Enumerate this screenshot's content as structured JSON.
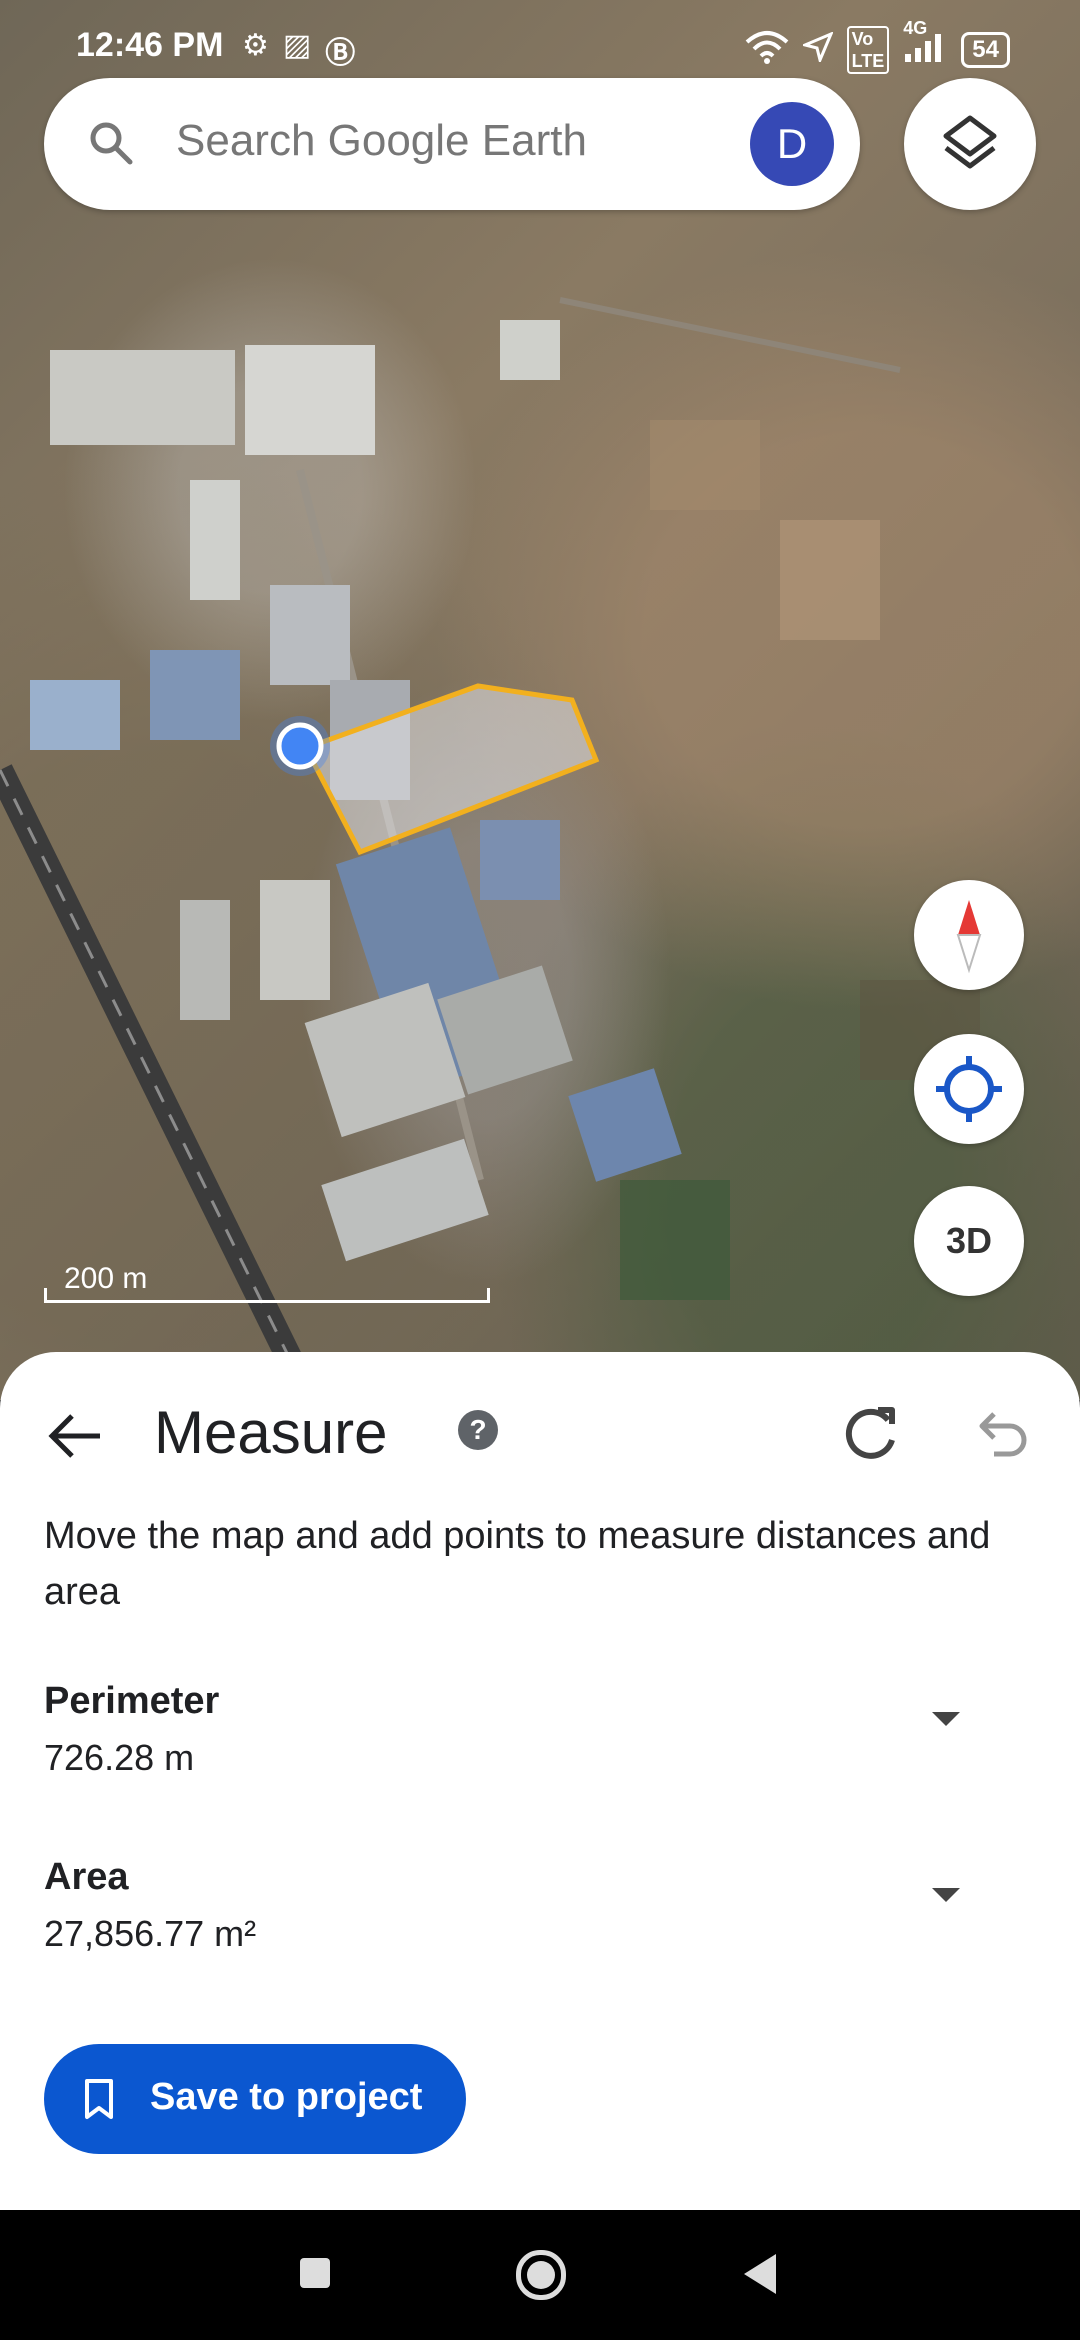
{
  "status_bar": {
    "time": "12:46 PM",
    "left_icons": [
      "gear-icon",
      "photo-icon",
      "b-badge-icon"
    ],
    "right_icons": [
      "wifi-icon",
      "location-arrow-icon",
      "volte-icon",
      "signal-4g-icon"
    ],
    "network": "4G",
    "battery": "54"
  },
  "search": {
    "placeholder": "Search Google Earth",
    "avatar_letter": "D",
    "avatar_color": "#3649b5"
  },
  "map": {
    "scale_label": "200 m",
    "measure_polygon_color": "#f2b01e",
    "location_dot_color": "#4285f4"
  },
  "map_controls": {
    "compass": "compass-icon",
    "my_location": "my-location-icon",
    "three_d_label": "3D",
    "layers": "layers-icon"
  },
  "measure": {
    "title": "Measure",
    "help_glyph": "?",
    "description": "Move the map and add points to measure distances and area",
    "perimeter": {
      "label": "Perimeter",
      "value": "726.28 m"
    },
    "area": {
      "label": "Area",
      "value": "27,856.77 m²"
    },
    "save_label": "Save to project",
    "accent_color": "#0b57d0"
  }
}
